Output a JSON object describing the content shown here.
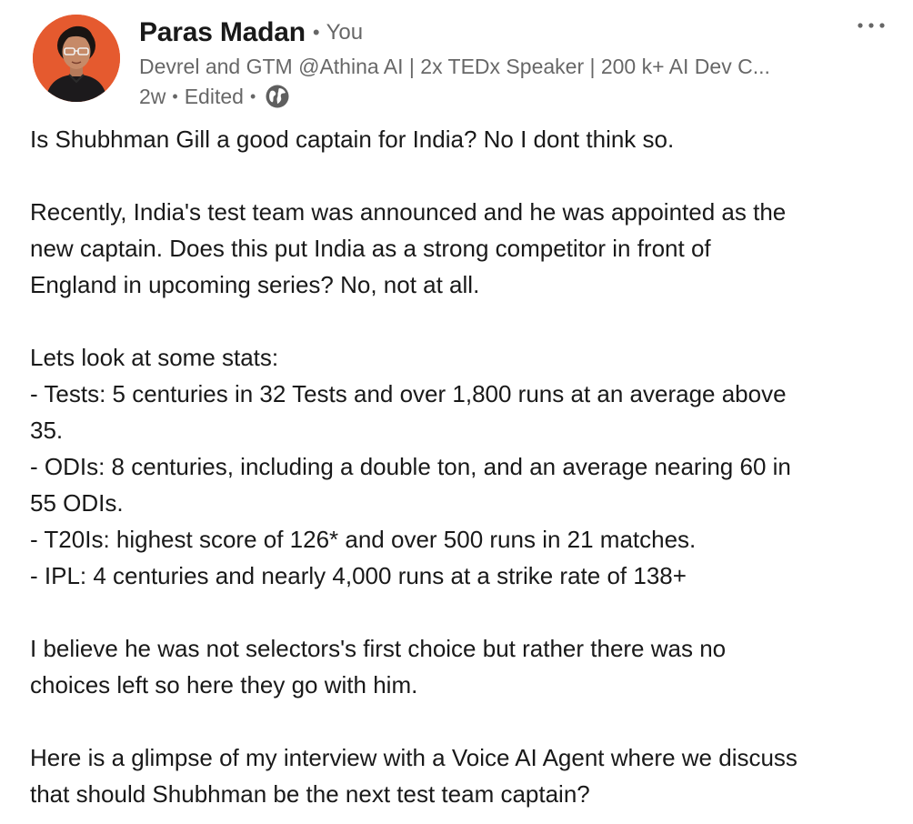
{
  "author": {
    "name": "Paras Madan",
    "relation": "You",
    "headline": "Devrel and GTM @Athina AI | 2x TEDx Speaker | 200 k+ AI Dev C...",
    "time": "2w",
    "edited": "Edited",
    "visibility_icon": "globe-icon",
    "avatar_bg": "#e55a2f"
  },
  "menu": {
    "icon": "more-horizontal-icon"
  },
  "post": {
    "lines": [
      "Is Shubhman Gill a good captain for India? No I dont think so.",
      "",
      "Recently, India's test team was announced and he was appointed as the",
      "new captain. Does this put India as a strong competitor in front of",
      "England in upcoming series? No, not at all.",
      "",
      "Lets look at some stats:",
      "- Tests: 5 centuries in 32 Tests and over 1,800 runs at an average above",
      "35.",
      "- ODIs: 8 centuries, including a double ton, and an average nearing 60 in",
      "55 ODIs.",
      "- T20Is: highest score of 126* and over 500 runs in 21 matches.",
      "- IPL: 4 centuries and nearly 4,000 runs at a strike rate of 138+",
      "",
      "I believe he was not selectors's first choice but rather there was no",
      "choices left so here they go with him.",
      "",
      "Here is a glimpse of my interview with a Voice AI Agent where we discuss",
      "that should Shubhman be the next test team captain?"
    ]
  }
}
